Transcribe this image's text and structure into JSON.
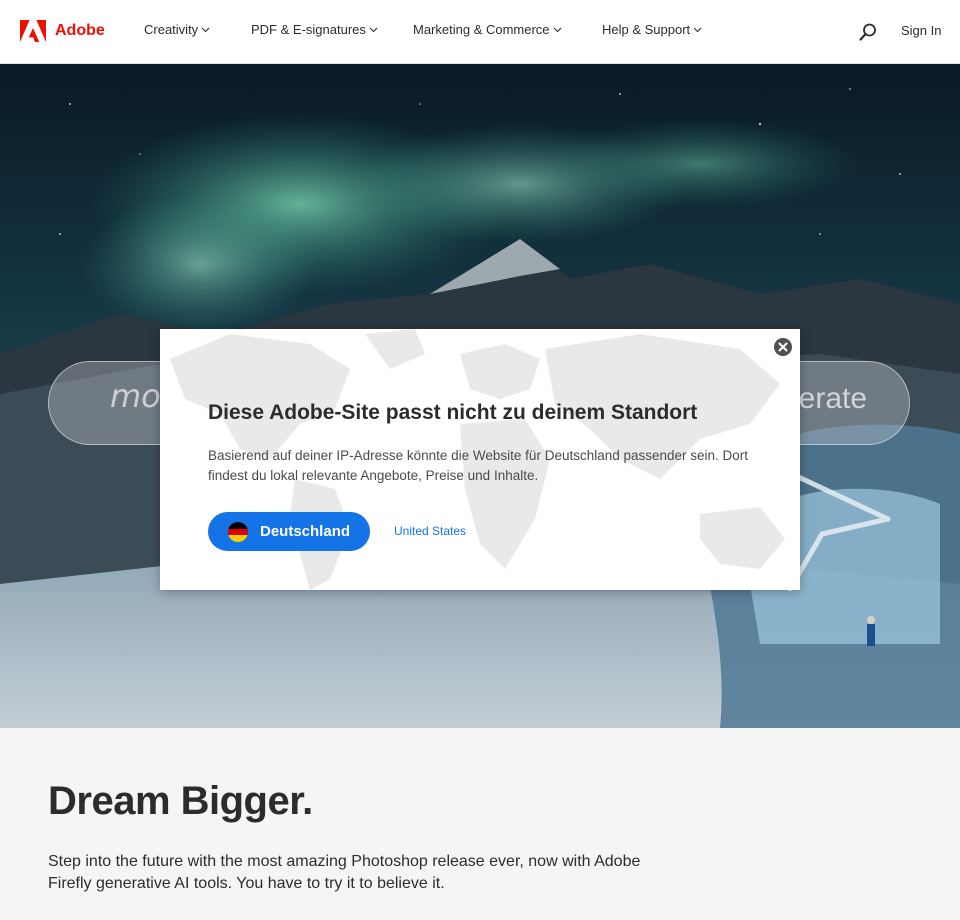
{
  "header": {
    "brand": "Adobe",
    "nav": [
      {
        "label": "Creativity"
      },
      {
        "label": "PDF & E-signatures"
      },
      {
        "label": "Marketing & Commerce"
      },
      {
        "label": "Help & Support"
      }
    ],
    "sign_in": "Sign In",
    "icons": {
      "logo": "adobe-logo-icon",
      "search": "search-icon",
      "caret": "chevron-down-icon"
    },
    "brand_color": "#eb1000"
  },
  "hero": {
    "prompt_left": "mo",
    "prompt_right": "nerate"
  },
  "modal": {
    "title": "Diese Adobe-Site passt nicht zu deinem Standort",
    "body": "Basierend auf deiner IP-Adresse könnte die Website für Deutschland passender sein. Dort findest du lokal relevante Angebote, Preise und Inhalte.",
    "primary_button": "Deutschland",
    "secondary_link": "United States",
    "icons": {
      "close": "close-icon",
      "flag": "germany-flag-icon"
    },
    "accent_color": "#1473e6"
  },
  "content": {
    "title": "Dream Bigger.",
    "description": "Step into the future with the most amazing Photoshop release ever, now with Adobe Firefly generative AI tools. You have to try it to believe it."
  }
}
